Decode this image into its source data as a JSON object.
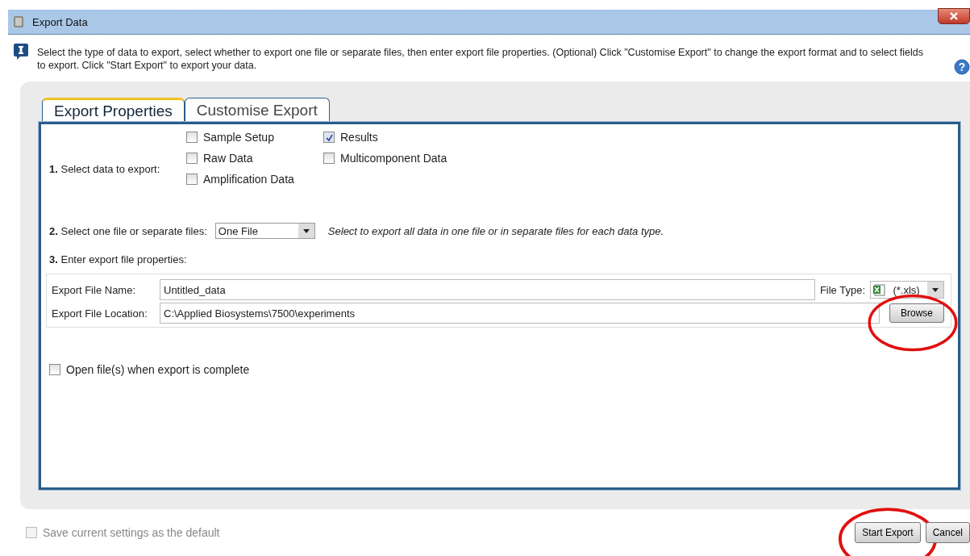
{
  "window": {
    "title": "Export Data"
  },
  "instructions": "Select the type of data to export, select whether to export one file or separate files, then enter export file properties. (Optional) Click \"Customise Export\" to change the export format and to select fields to export. Click \"Start Export\" to export your data.",
  "help": {
    "glyph": "?"
  },
  "tabs": [
    {
      "label": "Export Properties",
      "selected": true
    },
    {
      "label": "Customise Export",
      "selected": false
    }
  ],
  "step1": {
    "number": "1.",
    "label": "Select data to export:",
    "options": [
      {
        "label": "Sample Setup",
        "checked": false
      },
      {
        "label": "Raw Data",
        "checked": false
      },
      {
        "label": "Amplification Data",
        "checked": false
      },
      {
        "label": "Results",
        "checked": true
      },
      {
        "label": "Multicomponent Data",
        "checked": false
      }
    ]
  },
  "step2": {
    "number": "2.",
    "label": "Select one file or separate files:",
    "value": "One File",
    "hint": "Select to export all data in one file or in separate files for each data type."
  },
  "step3": {
    "number": "3.",
    "label": "Enter export file properties:"
  },
  "file_name": {
    "label": "Export File Name:",
    "value": "Untitled_data"
  },
  "file_type": {
    "label": "File Type:",
    "value": "(*.xls)"
  },
  "file_location": {
    "label": "Export File Location:",
    "value": "C:\\Applied Biosystems\\7500\\experiments"
  },
  "browse_button": {
    "label": "Browse",
    "circled": true
  },
  "open_when_complete": {
    "label": "Open file(s) when export is complete",
    "checked": false
  },
  "save_default": {
    "label": "Save current settings as the default",
    "checked": false,
    "disabled": true
  },
  "buttons": [
    {
      "label": "Start Export",
      "circled": true
    },
    {
      "label": "Cancel",
      "circled": false
    }
  ]
}
